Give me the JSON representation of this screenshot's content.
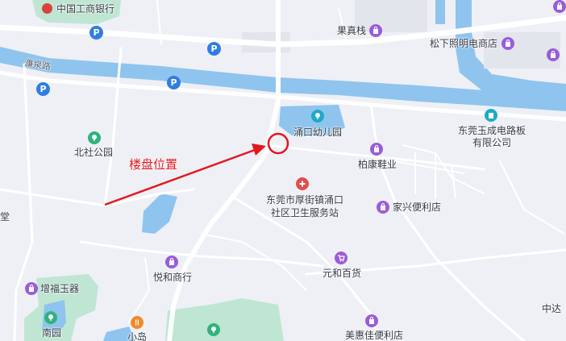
{
  "map": {
    "annotation": {
      "label": "楼盘位置",
      "color": "#e0191f"
    },
    "colors": {
      "background": "#eef0f5",
      "water": "#8fc4ee",
      "green": "#bfe6d2",
      "road": "#ffffff"
    },
    "roads": [
      {
        "name": "濂泉路"
      }
    ],
    "pois": [
      {
        "name": "中国工商银行",
        "icon": "bank-icon",
        "category": "bank"
      },
      {
        "name": "果真栈",
        "icon": "shopping-bag-icon",
        "category": "shop"
      },
      {
        "name": "松下照明电商店",
        "icon": "shopping-bag-icon",
        "category": "shop"
      },
      {
        "name": "涌口幼儿园",
        "icon": "school-icon",
        "category": "education"
      },
      {
        "name": "北社公园",
        "icon": "park-icon",
        "category": "park"
      },
      {
        "name": "东莞玉成电路板有限公司",
        "line1": "东莞玉成电路板",
        "line2": "有限公司",
        "icon": "company-icon",
        "category": "company"
      },
      {
        "name": "柏康鞋业",
        "icon": "shopping-bag-icon",
        "category": "shop"
      },
      {
        "name": "东莞市厚街镇涌口社区卫生服务站",
        "line1": "东莞市厚街镇涌口",
        "line2": "社区卫生服务站",
        "icon": "hospital-icon",
        "category": "hospital"
      },
      {
        "name": "家兴便利店",
        "icon": "shopping-bag-icon",
        "category": "shop"
      },
      {
        "name": "元和百货",
        "icon": "cart-icon",
        "category": "shop"
      },
      {
        "name": "悦和商行",
        "icon": "shopping-bag-icon",
        "category": "shop"
      },
      {
        "name": "增福玉器",
        "icon": "shopping-bag-icon",
        "category": "shop"
      },
      {
        "name": "南园",
        "icon": "park-icon",
        "category": "park"
      },
      {
        "name": "小岛",
        "icon": "food-icon",
        "category": "food"
      },
      {
        "name": "美惠佳便利店",
        "icon": "shopping-bag-icon",
        "category": "shop"
      },
      {
        "name": "中达",
        "icon": "none",
        "category": "company"
      },
      {
        "name": "堂",
        "icon": "none",
        "category": "other"
      }
    ],
    "parking_symbol": "P"
  }
}
